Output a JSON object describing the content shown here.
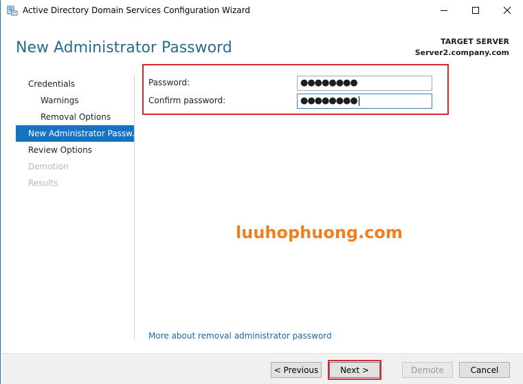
{
  "window": {
    "title": "Active Directory Domain Services Configuration Wizard"
  },
  "header": {
    "title": "New Administrator Password",
    "target_label": "TARGET SERVER",
    "target_server": "Server2.company.com"
  },
  "nav": {
    "items": [
      {
        "label": "Credentials",
        "state": "normal"
      },
      {
        "label": "Warnings",
        "state": "sub"
      },
      {
        "label": "Removal Options",
        "state": "sub"
      },
      {
        "label": "New Administrator Passw...",
        "state": "active"
      },
      {
        "label": "Review Options",
        "state": "normal"
      },
      {
        "label": "Demotion",
        "state": "disabled"
      },
      {
        "label": "Results",
        "state": "disabled"
      }
    ]
  },
  "form": {
    "password_label": "Password:",
    "password_value": "●●●●●●●●",
    "confirm_label": "Confirm password:",
    "confirm_value": "●●●●●●●●"
  },
  "watermark": "luuhophuong.com",
  "help_link": "More about removal administrator password",
  "footer": {
    "previous_label": "< Previous",
    "next_label": "Next >",
    "demote_label": "Demote",
    "cancel_label": "Cancel"
  },
  "colors": {
    "accent": "#1673c2",
    "title": "#2a6a8c",
    "highlight": "#d9262e",
    "watermark": "#f07f1f",
    "link": "#1e63a6"
  }
}
